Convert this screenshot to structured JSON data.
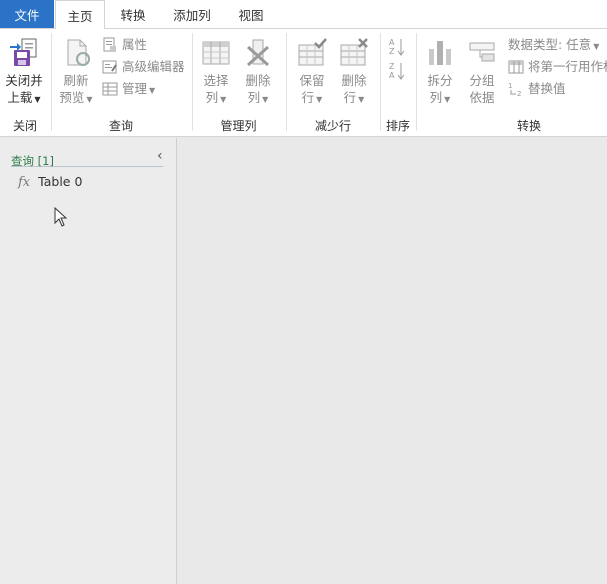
{
  "tabs": {
    "file": "文件",
    "home": "主页",
    "transform": "转换",
    "add_column": "添加列",
    "view": "视图"
  },
  "groups": {
    "close": "关闭",
    "query": "查询",
    "manage_columns": "管理列",
    "reduce_rows": "减少行",
    "sort": "排序",
    "transform": "转换"
  },
  "buttons": {
    "close_load_line1": "关闭并",
    "close_load_line2": "上载",
    "refresh_line1": "刷新",
    "refresh_line2": "预览",
    "properties": "属性",
    "advanced_editor": "高级编辑器",
    "manage": "管理",
    "choose_cols_line1": "选择",
    "choose_cols_line2": "列",
    "remove_cols_line1": "删除",
    "remove_cols_line2": "列",
    "keep_rows_line1": "保留",
    "keep_rows_line2": "行",
    "remove_rows_line1": "删除",
    "remove_rows_line2": "行",
    "split_col_line1": "拆分",
    "split_col_line2": "列",
    "group_by_line1": "分组",
    "group_by_line2": "依据",
    "data_type": "数据类型: 任意",
    "first_row_header": "将第一行用作标",
    "replace_values": "替换值"
  },
  "queries_pane": {
    "title": "查询 [1]",
    "items": [
      {
        "name": "Table 0"
      }
    ]
  },
  "colors": {
    "file_tab": "#2b73c7",
    "query_title": "#2e7d4a",
    "disabled_text": "#8a8a8a"
  }
}
